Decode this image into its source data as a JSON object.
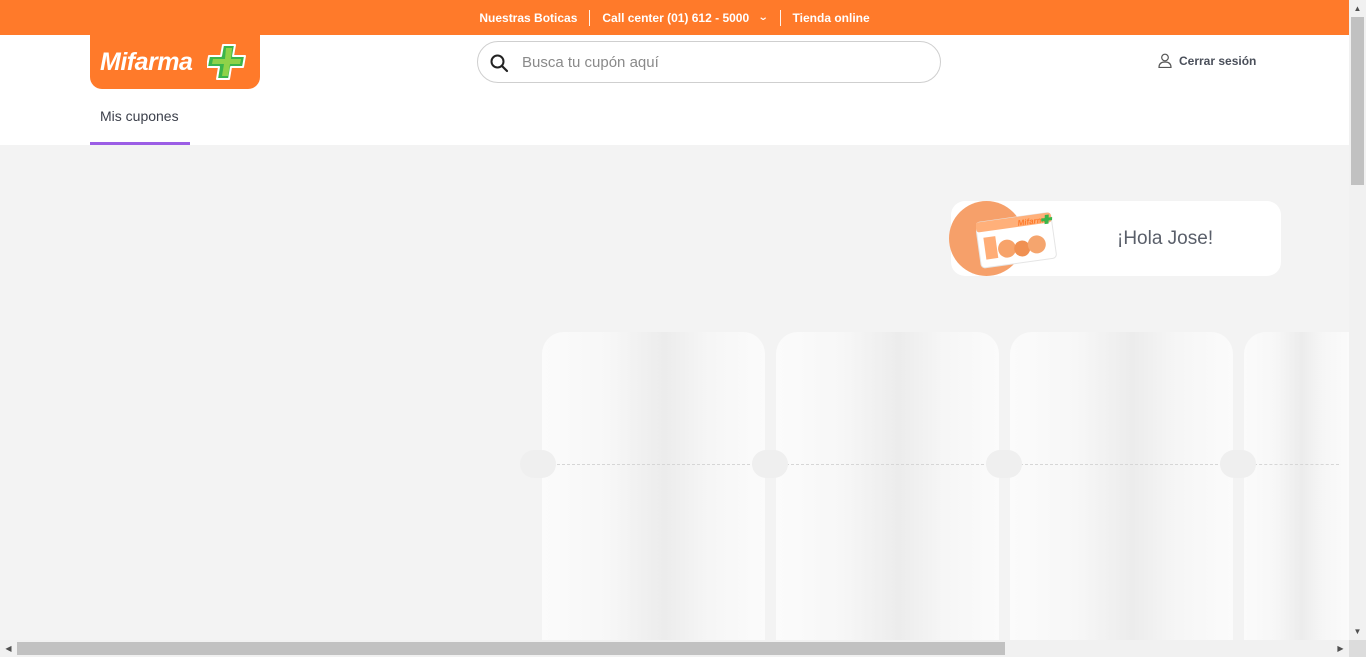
{
  "topbar": {
    "stores_label": "Nuestras Boticas",
    "callcenter_label": "Call center (01) 612 - 5000",
    "store_online_label": "Tienda online"
  },
  "brand": {
    "logo_text": "Mifarma",
    "primary_color": "#ff7a2a",
    "cross_color": "#3bb54a"
  },
  "search": {
    "placeholder": "Busca tu cupón aquí",
    "value": ""
  },
  "header": {
    "logout_label": "Cerrar sesión"
  },
  "tabs": [
    {
      "label": "Mis cupones",
      "active": true
    }
  ],
  "greeting": {
    "text": "¡Hola Jose!"
  },
  "colors": {
    "tab_indicator": "#9b5de5",
    "page_bg": "#f3f3f3"
  }
}
